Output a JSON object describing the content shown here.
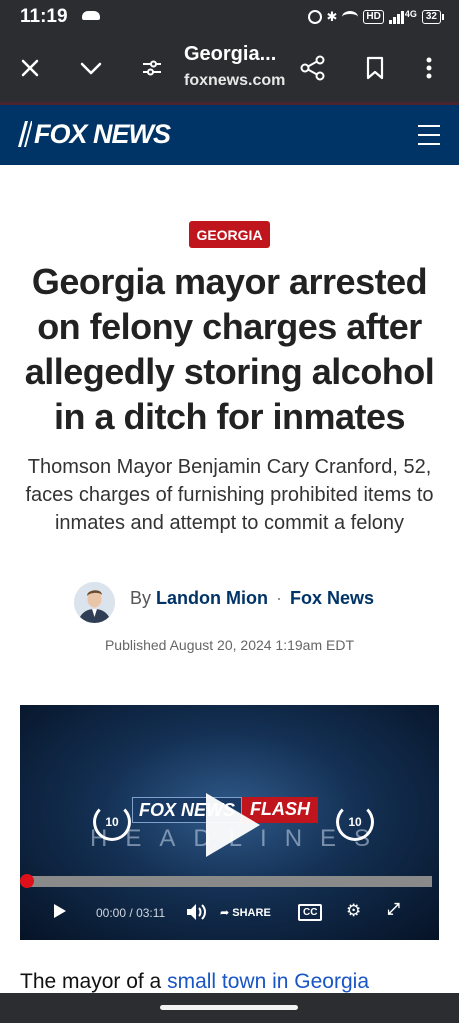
{
  "status_bar": {
    "time": "11:19",
    "hd": "HD",
    "network": "4G",
    "battery": "32"
  },
  "browser": {
    "page_title": "Georgia...",
    "domain": "foxnews.com",
    "icons": [
      "close-icon",
      "chevron-down-icon",
      "tune-icon",
      "share-icon",
      "bookmark-icon",
      "more-icon"
    ]
  },
  "site_header": {
    "logo_text": "FOX NEWS",
    "brand_color": "#003366",
    "menu_icon": "hamburger-menu-icon"
  },
  "article": {
    "category": "GEORGIA",
    "category_color": "#c0151d",
    "headline": "Georgia mayor arrested on felony charges after allegedly storing alcohol in a ditch for inmates",
    "subheadline": "Thomson Mayor Benjamin Cary Cranford, 52, faces charges of furnishing prohibited items to inmates and attempt to commit a felony",
    "byline_prefix": "By",
    "author": "Landon Mion",
    "outlet": "Fox News",
    "published": "Published August 20, 2024 1:19am EDT",
    "body_start": "The mayor of a",
    "body_link": "small town in Georgia"
  },
  "video": {
    "logo_fox": "FOX NEWS",
    "logo_flash": "FLASH",
    "logo_headlines": "HEADLINES",
    "skip_back": "10",
    "skip_forward": "10",
    "current_time": "00:00",
    "time_separator": "/",
    "duration": "03:11",
    "share_label": "SHARE",
    "cc_label": "CC",
    "progress_fraction": 0.0
  }
}
